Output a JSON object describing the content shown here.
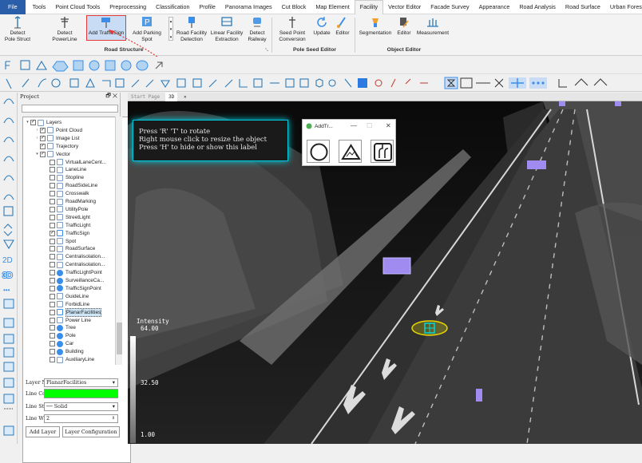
{
  "menu": [
    "File",
    "Tools",
    "Point Cloud Tools",
    "Preprocessing",
    "Classification",
    "Profile",
    "Panorama Images",
    "Cut Block",
    "Map Element",
    "Facility",
    "Vector Editor",
    "Facade Survey",
    "Appearance",
    "Road Analysis",
    "Road Surface",
    "Urban Forestry"
  ],
  "ribbon": {
    "buttons": [
      {
        "label": "Detect\nPole Struct"
      },
      {
        "label": "Detect\nPowerLine"
      },
      {
        "label": "Add TrafficSign"
      },
      {
        "label": "Add Parking\nSpot"
      },
      {
        "label": "Road Facility\nDetection"
      },
      {
        "label": "Linear Facility\nExtraction"
      },
      {
        "label": "Detect\nRailway"
      },
      {
        "label": "Seed Point\nConversion"
      },
      {
        "label": "Update"
      },
      {
        "label": "Editor"
      },
      {
        "label": "Segmentation"
      },
      {
        "label": "Editor"
      },
      {
        "label": "Measurement"
      }
    ],
    "groups": [
      "Road Structure",
      "Pole Seed Editor",
      "Object Editor"
    ]
  },
  "project": {
    "title": "Project",
    "tree": [
      {
        "label": "Layers",
        "level": 0,
        "checked": true,
        "exp": "▾",
        "icon": "layers-icon"
      },
      {
        "label": "Point Cloud",
        "level": 1,
        "checked": true,
        "exp": "›",
        "icon": "point-cloud-icon"
      },
      {
        "label": "Image List",
        "level": 1,
        "checked": true,
        "exp": "›",
        "icon": "image-list-icon"
      },
      {
        "label": "Trajectory",
        "level": 1,
        "checked": true,
        "exp": "",
        "icon": "trajectory-icon"
      },
      {
        "label": "Vector",
        "level": 1,
        "checked": true,
        "exp": "▾",
        "icon": "vector-icon"
      },
      {
        "label": "VirtualLaneCent...",
        "level": 2,
        "checked": false,
        "icon": "virtual-lane-icon"
      },
      {
        "label": "LaneLine",
        "level": 2,
        "checked": false,
        "icon": "lane-line-icon"
      },
      {
        "label": "Stopline",
        "level": 2,
        "checked": false,
        "icon": "stopline-icon"
      },
      {
        "label": "RoadSideLine",
        "level": 2,
        "checked": false,
        "icon": "road-side-line-icon"
      },
      {
        "label": "Crosswalk",
        "level": 2,
        "checked": false,
        "icon": "crosswalk-icon"
      },
      {
        "label": "RoadMarking",
        "level": 2,
        "checked": false,
        "icon": "road-marking-icon"
      },
      {
        "label": "UtilityPole",
        "level": 2,
        "checked": false,
        "icon": "utility-pole-icon"
      },
      {
        "label": "StreetLight",
        "level": 2,
        "checked": false,
        "icon": "street-light-icon"
      },
      {
        "label": "TrafficLight",
        "level": 2,
        "checked": false,
        "icon": "traffic-light-icon"
      },
      {
        "label": "TrafficSign",
        "level": 2,
        "checked": true,
        "icon": "traffic-sign-icon"
      },
      {
        "label": "Spot",
        "level": 2,
        "checked": false,
        "icon": "spot-icon"
      },
      {
        "label": "RoadSurface",
        "level": 2,
        "checked": false,
        "icon": "road-surface-icon"
      },
      {
        "label": "Centralisolation...",
        "level": 2,
        "checked": false,
        "icon": "central-isolation-icon"
      },
      {
        "label": "Centralisolation...",
        "level": 2,
        "checked": false,
        "icon": "central-isolation-icon"
      },
      {
        "label": "TrafficLightPoint",
        "level": 2,
        "checked": false,
        "icon": "point-icon"
      },
      {
        "label": "SurveillanceCa...",
        "level": 2,
        "checked": false,
        "icon": "point-icon"
      },
      {
        "label": "TrafficSignPoint",
        "level": 2,
        "checked": false,
        "icon": "point-icon"
      },
      {
        "label": "GuideLine",
        "level": 2,
        "checked": false,
        "icon": "guide-line-icon"
      },
      {
        "label": "ForbidLine",
        "level": 2,
        "checked": false,
        "icon": "forbid-line-icon"
      },
      {
        "label": "PlanarFacilities",
        "level": 2,
        "checked": false,
        "selected": true,
        "icon": "planar-facilities-icon"
      },
      {
        "label": "Power Line",
        "level": 2,
        "checked": false,
        "icon": "power-line-icon"
      },
      {
        "label": "Tree",
        "level": 2,
        "checked": false,
        "icon": "point-icon"
      },
      {
        "label": "Pole",
        "level": 2,
        "checked": false,
        "icon": "point-icon"
      },
      {
        "label": "Car",
        "level": 2,
        "checked": false,
        "icon": "point-icon"
      },
      {
        "label": "Building",
        "level": 2,
        "checked": false,
        "icon": "point-icon"
      },
      {
        "label": "AuxiliaryLine",
        "level": 2,
        "checked": false,
        "icon": "auxiliary-line-icon"
      }
    ],
    "props": {
      "layer_name_label": "Layer Name",
      "layer_name": "PlanarFacilities",
      "line_color_label": "Line Color",
      "line_color": "#00ff00",
      "line_style_label": "Line Style",
      "line_style": "Solid",
      "line_width_label": "Line Width",
      "line_width": "2",
      "add_layer": "Add Layer",
      "layer_config": "Layer Configuration"
    }
  },
  "tabs": [
    "Start Page",
    "3D"
  ],
  "viewport": {
    "hint_lines": [
      "Press 'R' 'T' to rotate",
      "Right mouse click to resize the object",
      "Press 'H' to hide or show this label"
    ],
    "popup_title": "AddTr...",
    "legend_title": "Intensity",
    "legend_values": [
      "64.00",
      "32.50",
      "1.00"
    ]
  },
  "colors": {
    "accent": "#2a5ea8",
    "highlight": "#e53935",
    "select_box": "#c9dcf5",
    "cyan": "#00c8d8",
    "marker": "#e8d800",
    "purple": "#a08cf0"
  }
}
